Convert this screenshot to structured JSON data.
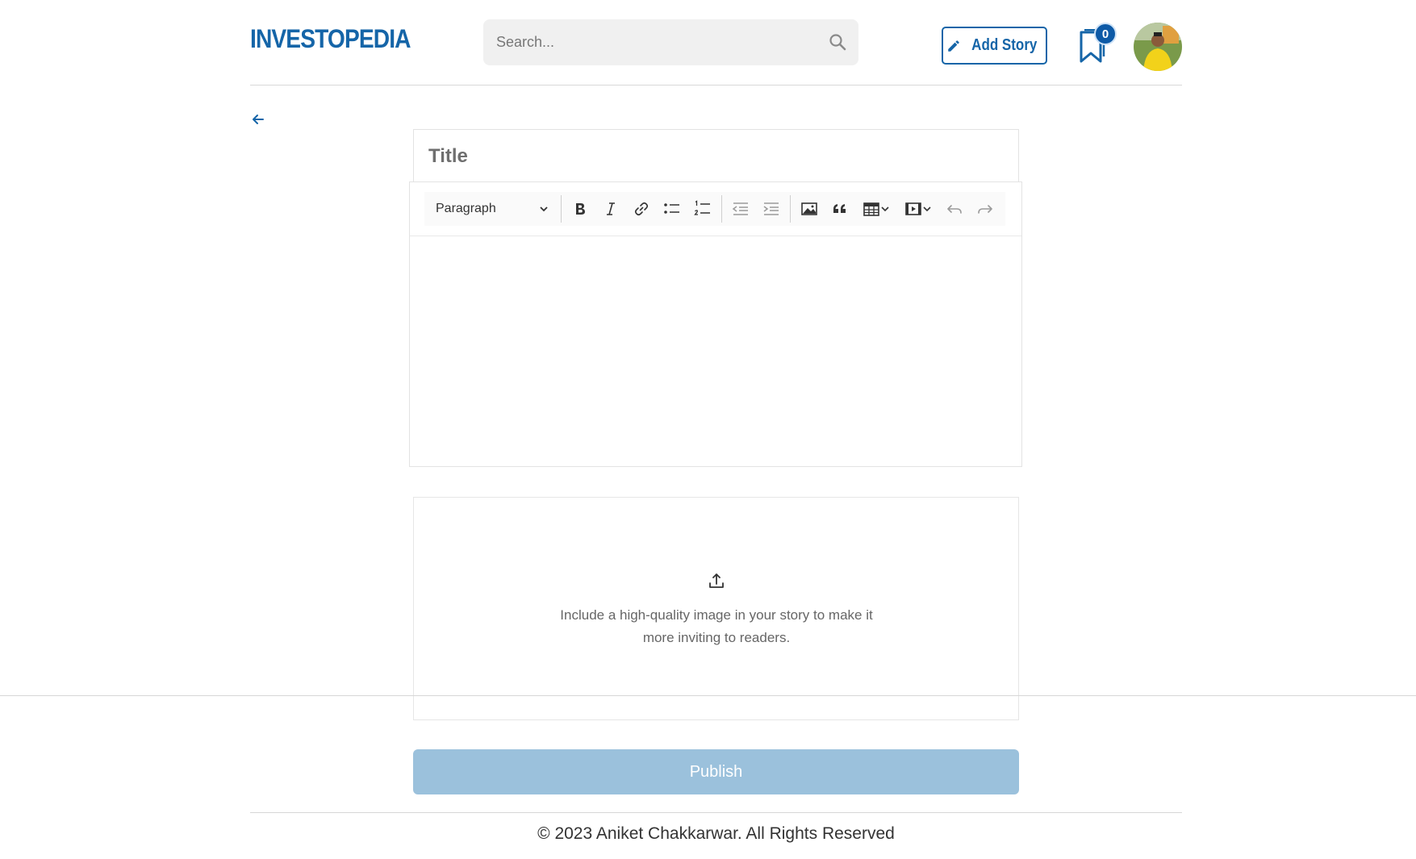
{
  "header": {
    "logo": "INVESTOPEDIA",
    "search": {
      "placeholder": "Search..."
    },
    "add_story_label": "Add Story",
    "bookmark_count": "0"
  },
  "editor": {
    "title_placeholder": "Title",
    "paragraph_select": "Paragraph",
    "toolbar_icons": [
      "bold-icon",
      "italic-icon",
      "link-icon",
      "bulleted-list-icon",
      "numbered-list-icon",
      "outdent-icon",
      "indent-icon",
      "image-icon",
      "blockquote-icon",
      "table-icon",
      "media-embed-icon",
      "undo-icon",
      "redo-icon"
    ]
  },
  "upload": {
    "text": "Include a high-quality image in your story to make it more inviting to readers."
  },
  "publish_label": "Publish",
  "footer": {
    "copyright": "© 2023 Aniket Chakkarwar. All Rights Reserved"
  },
  "colors": {
    "brand": "#1565a8",
    "publish_disabled": "#9bc1dc",
    "badge": "#0d5aa7"
  }
}
